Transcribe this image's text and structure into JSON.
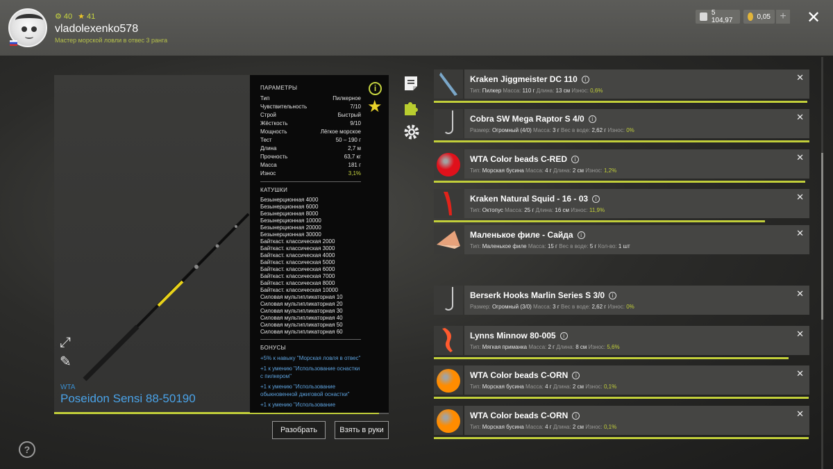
{
  "header": {
    "stat_1": "40",
    "stat_2": "41",
    "username": "vladolexenko578",
    "rank": "Мастер морской ловли в отвес 3 ранга",
    "silver": "5 104,97",
    "gold": "0,05"
  },
  "rod": {
    "brand": "WTA",
    "name": "Poseidon Sensi 88-50190",
    "durability_remaining_fraction": 0.97
  },
  "params": {
    "title": "ПАРАМЕТРЫ",
    "rows": [
      {
        "k": "Тип",
        "v": "Пилкерное"
      },
      {
        "k": "Чувствительность",
        "v": "7/10"
      },
      {
        "k": "Строй",
        "v": "Быстрый"
      },
      {
        "k": "Жёсткость",
        "v": "9/10"
      },
      {
        "k": "Мощность",
        "v": "Лёгкое морское"
      },
      {
        "k": "Тест",
        "v": "50 – 190 г"
      },
      {
        "k": "Длина",
        "v": "2,7 м"
      },
      {
        "k": "Прочность",
        "v": "63,7 кг"
      },
      {
        "k": "Масса",
        "v": "181 г"
      },
      {
        "k": "Износ",
        "v": "3,1%"
      }
    ],
    "reels_title": "КАТУШКИ",
    "reels": [
      "Безынерционная 4000",
      "Безынерционная 6000",
      "Безынерционная 8000",
      "Безынерционная 10000",
      "Безынерционная 20000",
      "Безынерционная 30000",
      "Байткаст. классическая 2000",
      "Байткаст. классическая 3000",
      "Байткаст. классическая 4000",
      "Байткаст. классическая 5000",
      "Байткаст. классическая 6000",
      "Байткаст. классическая 7000",
      "Байткаст. классическая 8000",
      "Байткаст. классическая 10000",
      "Силовая мультипликаторная 10",
      "Силовая мультипликаторная 20",
      "Силовая мультипликаторная 30",
      "Силовая мультипликаторная 40",
      "Силовая мультипликаторная 50",
      "Силовая мультипликаторная 60"
    ],
    "bonus_title": "БОНУСЫ",
    "bonuses": [
      "+5% к навыку \"Морская ловля в отвес\"",
      "+1 к умению \"Использование оснастки с пилкером\"",
      "+1 к умению \"Использование обыкновенной джиговой оснастки\"",
      "+1 к умению \"Использование"
    ]
  },
  "buttons": {
    "disassemble": "Разобрать",
    "take": "Взять в руки"
  },
  "items": [
    {
      "name": "Kraken Jiggmeister DC 110",
      "l1": "Тип:",
      "v1": "Пилкер",
      "l2": "Масса:",
      "v2": "110 г",
      "l3": "Длина:",
      "v3": "13 см",
      "l4": "Износ:",
      "v4": "0,6%",
      "wear": 0.994,
      "icon": "jig-icon"
    },
    {
      "name": "Cobra SW Mega Raptor S 4/0",
      "l1": "Размер:",
      "v1": "Огромный (4/0)",
      "l2": "Масса:",
      "v2": "3 г",
      "l3": "Вес в воде:",
      "v3": "2,62 г",
      "l4": "Износ:",
      "v4": "0%",
      "wear": 1.0,
      "icon": "hook-icon"
    },
    {
      "name": "WTA Color beads C-RED",
      "l1": "Тип:",
      "v1": "Морская бусина",
      "l2": "Масса:",
      "v2": "4 г",
      "l3": "Длина:",
      "v3": "2 см",
      "l4": "Износ:",
      "v4": "1,2%",
      "wear": 0.988,
      "icon": "red-bead-icon",
      "color": "#e0111b"
    },
    {
      "name": "Kraken Natural Squid - 16 - 03",
      "l1": "Тип:",
      "v1": "Октопус",
      "l2": "Масса:",
      "v2": "25 г",
      "l3": "Длина:",
      "v3": "16 см",
      "l4": "Износ:",
      "v4": "11,9%",
      "wear": 0.881,
      "icon": "squid-icon"
    },
    {
      "name": "Маленькое филе - Сайда",
      "l1": "Тип:",
      "v1": "Маленькое филе",
      "l2": "Масса:",
      "v2": "15 г",
      "l3": "Вес в воде:",
      "v3": "5 г",
      "l4": "Кол-во:",
      "v4": "1 шт",
      "wear": null,
      "icon": "fillet-icon"
    },
    {
      "name": "Berserk Hooks Marlin Series S 3/0",
      "l1": "Размер:",
      "v1": "Огромный (3/0)",
      "l2": "Масса:",
      "v2": "3 г",
      "l3": "Вес в воде:",
      "v3": "2,62 г",
      "l4": "Износ:",
      "v4": "0%",
      "wear": null,
      "icon": "hook-icon"
    },
    {
      "name": "Lynns Minnow 80-005",
      "l1": "Тип:",
      "v1": "Мягкая приманка",
      "l2": "Масса:",
      "v2": "2 г",
      "l3": "Длина:",
      "v3": "8 см",
      "l4": "Износ:",
      "v4": "5,6%",
      "wear": 0.944,
      "icon": "soft-bait-icon"
    },
    {
      "name": "WTA Color beads C-ORN",
      "l1": "Тип:",
      "v1": "Морская бусина",
      "l2": "Масса:",
      "v2": "4 г",
      "l3": "Длина:",
      "v3": "2 см",
      "l4": "Износ:",
      "v4": "0,1%",
      "wear": 0.999,
      "icon": "orange-bead-icon",
      "color": "#ff8c00"
    },
    {
      "name": "WTA Color beads C-ORN",
      "l1": "Тип:",
      "v1": "Морская бусина",
      "l2": "Масса:",
      "v2": "4 г",
      "l3": "Длина:",
      "v3": "2 см",
      "l4": "Износ:",
      "v4": "0,1%",
      "wear": 0.999,
      "icon": "orange-bead-icon",
      "color": "#ff8c00"
    }
  ],
  "colors": {
    "accent": "#c2cf3a",
    "link": "#4aa3e8"
  }
}
